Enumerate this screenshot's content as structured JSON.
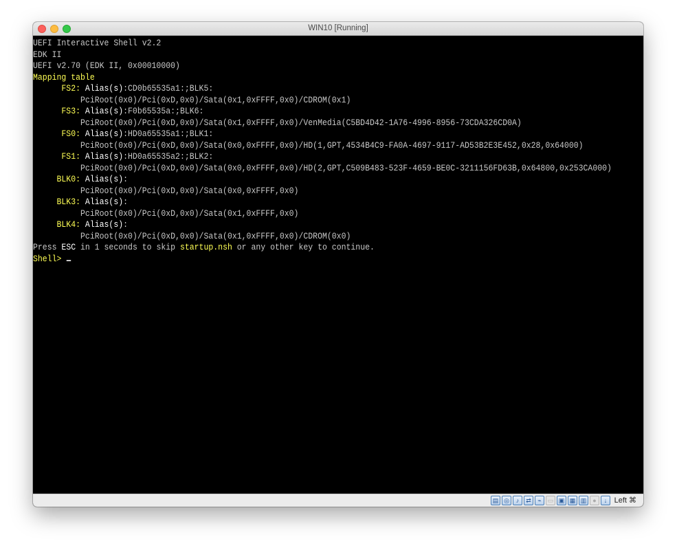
{
  "window": {
    "title": "WIN10 [Running]"
  },
  "terminal": {
    "lines": [
      [
        {
          "t": "UEFI Interactive Shell v2.2",
          "c": "g"
        }
      ],
      [
        {
          "t": "EDK II",
          "c": "g"
        }
      ],
      [
        {
          "t": "UEFI v2.70 (EDK II, 0x00010000)",
          "c": "g"
        }
      ],
      [
        {
          "t": "Mapping table",
          "c": "y"
        }
      ],
      [
        {
          "t": "      FS2: ",
          "c": "y"
        },
        {
          "t": "Alias(s)",
          "c": "w"
        },
        {
          "t": ":CD0b65535a1:;BLK5:",
          "c": "g"
        }
      ],
      [
        {
          "t": "          PciRoot(0x0)/Pci(0xD,0x0)/Sata(0x1,0xFFFF,0x0)/CDROM(0x1)",
          "c": "g"
        }
      ],
      [
        {
          "t": "      FS3: ",
          "c": "y"
        },
        {
          "t": "Alias(s)",
          "c": "w"
        },
        {
          "t": ":F0b65535a:;BLK6:",
          "c": "g"
        }
      ],
      [
        {
          "t": "          PciRoot(0x0)/Pci(0xD,0x0)/Sata(0x1,0xFFFF,0x0)/VenMedia(C5BD4D42-1A76-4996-8956-73CDA326CD0A)",
          "c": "g"
        }
      ],
      [
        {
          "t": "      FS0: ",
          "c": "y"
        },
        {
          "t": "Alias(s)",
          "c": "w"
        },
        {
          "t": ":HD0a65535a1:;BLK1:",
          "c": "g"
        }
      ],
      [
        {
          "t": "          PciRoot(0x0)/Pci(0xD,0x0)/Sata(0x0,0xFFFF,0x0)/HD(1,GPT,4534B4C9-FA0A-4697-9117-AD53B2E3E452,0x28,0x64000)",
          "c": "g"
        }
      ],
      [
        {
          "t": "      FS1: ",
          "c": "y"
        },
        {
          "t": "Alias(s)",
          "c": "w"
        },
        {
          "t": ":HD0a65535a2:;BLK2:",
          "c": "g"
        }
      ],
      [
        {
          "t": "          PciRoot(0x0)/Pci(0xD,0x0)/Sata(0x0,0xFFFF,0x0)/HD(2,GPT,C509B483-523F-4659-BE0C-3211156FD63B,0x64800,0x253CA000)",
          "c": "g"
        }
      ],
      [
        {
          "t": "     BLK0: ",
          "c": "y"
        },
        {
          "t": "Alias(s)",
          "c": "w"
        },
        {
          "t": ":",
          "c": "g"
        }
      ],
      [
        {
          "t": "          PciRoot(0x0)/Pci(0xD,0x0)/Sata(0x0,0xFFFF,0x0)",
          "c": "g"
        }
      ],
      [
        {
          "t": "     BLK3: ",
          "c": "y"
        },
        {
          "t": "Alias(s)",
          "c": "w"
        },
        {
          "t": ":",
          "c": "g"
        }
      ],
      [
        {
          "t": "          PciRoot(0x0)/Pci(0xD,0x0)/Sata(0x1,0xFFFF,0x0)",
          "c": "g"
        }
      ],
      [
        {
          "t": "     BLK4: ",
          "c": "y"
        },
        {
          "t": "Alias(s)",
          "c": "w"
        },
        {
          "t": ":",
          "c": "g"
        }
      ],
      [
        {
          "t": "          PciRoot(0x0)/Pci(0xD,0x0)/Sata(0x1,0xFFFF,0x0)/CDROM(0x0)",
          "c": "g"
        }
      ],
      [
        {
          "t": "Press ",
          "c": "g"
        },
        {
          "t": "ESC",
          "c": "w"
        },
        {
          "t": " in 1 seconds to skip ",
          "c": "g"
        },
        {
          "t": "startup.nsh",
          "c": "y"
        },
        {
          "t": " or any other key to continue.",
          "c": "g"
        }
      ],
      [
        {
          "t": "Shell> ",
          "c": "y"
        }
      ]
    ]
  },
  "statusbar": {
    "icons": [
      "hard-disk-icon",
      "optical-disc-icon",
      "audio-icon",
      "network-icon",
      "usb-icon",
      "shared-folder-icon",
      "display-icon",
      "screen-capture-icon",
      "cpu-icon",
      "recording-icon",
      "arrow-down-icon"
    ],
    "host_key": "Left ⌘"
  },
  "colors": {
    "g": "#c8c8c8",
    "y": "#ffff55",
    "w": "#ffffff",
    "background": "#000000"
  }
}
